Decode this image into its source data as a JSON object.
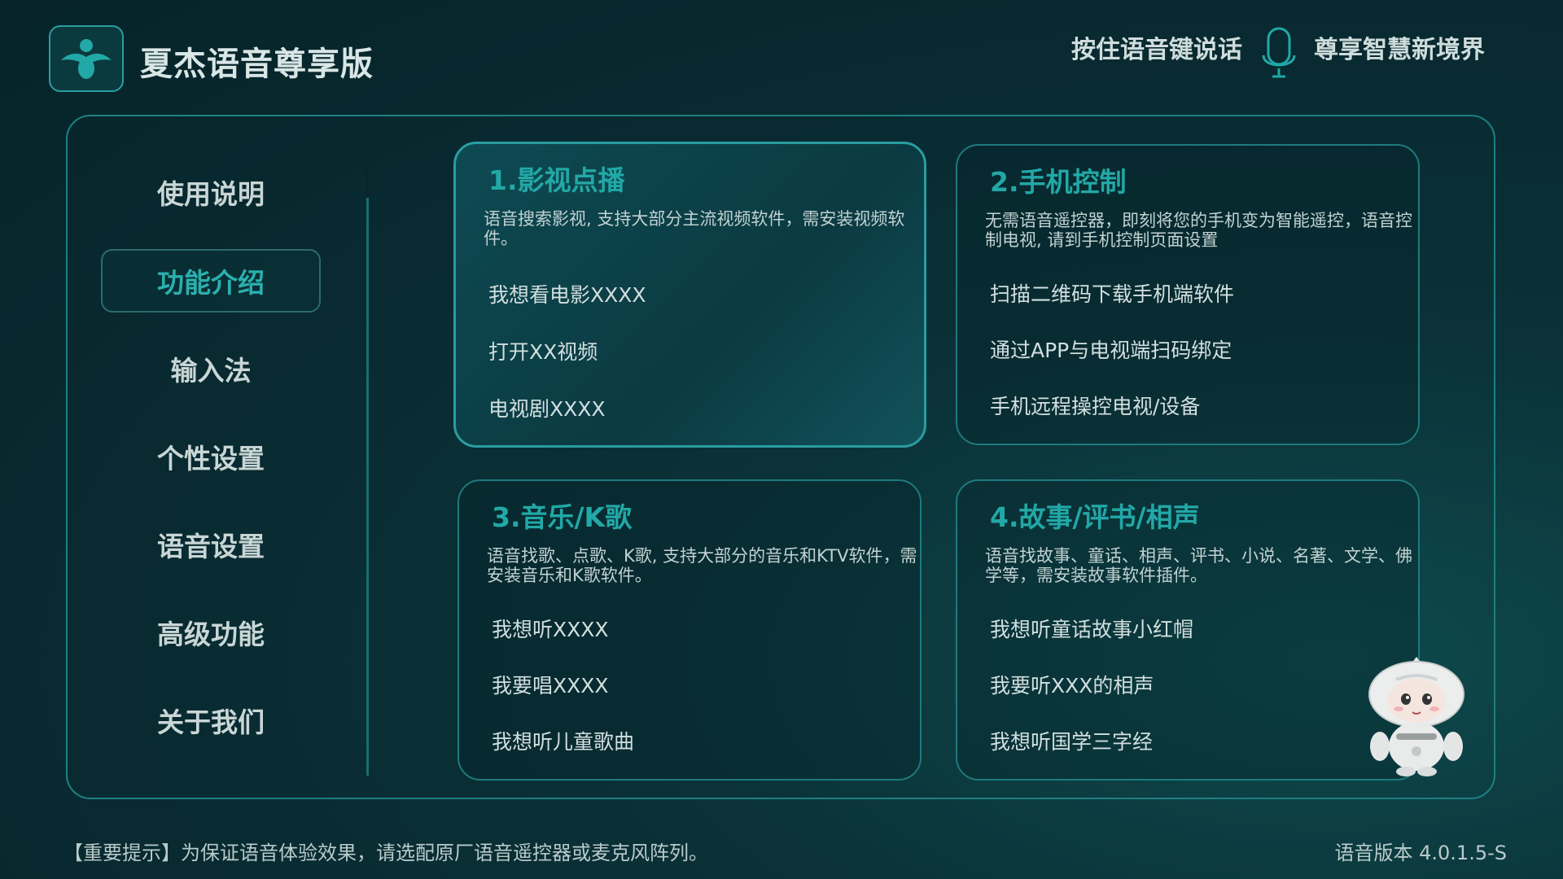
{
  "header": {
    "app_title": "夏杰语音尊享版",
    "hint_press": "按住语音键说话",
    "hint_slogan": "尊享智慧新境界",
    "logo_icon": "assistant-logo-icon",
    "mic_icon": "microphone-icon"
  },
  "sidebar": {
    "items": [
      {
        "label": "使用说明",
        "active": false
      },
      {
        "label": "功能介绍",
        "active": true
      },
      {
        "label": "输入法",
        "active": false
      },
      {
        "label": "个性设置",
        "active": false
      },
      {
        "label": "语音设置",
        "active": false
      },
      {
        "label": "高级功能",
        "active": false
      },
      {
        "label": "关于我们",
        "active": false
      }
    ]
  },
  "cards": [
    {
      "title": "1.影视点播",
      "desc": "语音搜索影视, 支持大部分主流视频软件，需安装视频软件。",
      "examples": [
        "我想看电影XXXX",
        "打开XX视频",
        "电视剧XXXX"
      ]
    },
    {
      "title": "2.手机控制",
      "desc": "无需语音遥控器，即刻将您的手机变为智能遥控，语音控制电视, 请到手机控制页面设置",
      "examples": [
        "扫描二维码下载手机端软件",
        "通过APP与电视端扫码绑定",
        "手机远程操控电视/设备"
      ]
    },
    {
      "title": "3.音乐/K歌",
      "desc": "语音找歌、点歌、K歌, 支持大部分的音乐和KTV软件，需安装音乐和K歌软件。",
      "examples": [
        "我想听XXXX",
        "我要唱XXXX",
        "我想听儿童歌曲"
      ]
    },
    {
      "title": "4.故事/评书/相声",
      "desc": "语音找故事、童话、相声、评书、小说、名著、文学、佛学等，需安装故事软件插件。",
      "examples": [
        "我想听童话故事小红帽",
        "我要听XXX的相声",
        "我想听国学三字经"
      ]
    }
  ],
  "footer": {
    "tip": "【重要提示】为保证语音体验效果，请选配原厂语音遥控器或麦克风阵列。",
    "version": "语音版本 4.0.1.5-S"
  },
  "mascot_icon": "robot-mascot-icon",
  "colors": {
    "accent": "#22a8a6",
    "border": "#1e7a7e",
    "background": "#082a30"
  }
}
